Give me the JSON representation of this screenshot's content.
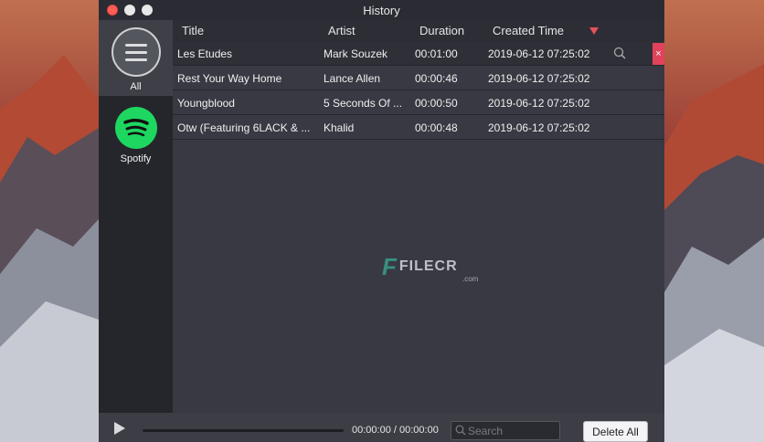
{
  "window": {
    "title": "History"
  },
  "sidebar": {
    "items": [
      {
        "label": "All",
        "icon": "menu-icon"
      },
      {
        "label": "Spotify",
        "icon": "spotify-icon"
      }
    ]
  },
  "table": {
    "columns": [
      "Title",
      "Artist",
      "Duration",
      "Created Time"
    ],
    "rows": [
      {
        "title": "Les Etudes",
        "artist": "Mark Souzek",
        "duration": "00:01:00",
        "created": "2019-06-12 07:25:02"
      },
      {
        "title": "Rest Your Way Home",
        "artist": "Lance Allen",
        "duration": "00:00:46",
        "created": "2019-06-12 07:25:02"
      },
      {
        "title": "Youngblood",
        "artist": "5 Seconds Of ...",
        "duration": "00:00:50",
        "created": "2019-06-12 07:25:02"
      },
      {
        "title": "Otw (Featuring 6LACK & ...",
        "artist": "Khalid",
        "duration": "00:00:48",
        "created": "2019-06-12 07:25:02"
      }
    ]
  },
  "watermark": {
    "letter": "F",
    "text": "FILECR",
    "suffix": ".com"
  },
  "player": {
    "time": "00:00:00 / 00:00:00"
  },
  "search": {
    "placeholder": "Search"
  },
  "actions": {
    "delete_all": "Delete All",
    "row_delete": "×"
  },
  "colors": {
    "accent": "#e8505b",
    "spotify": "#1ed760",
    "delete": "#e0435b"
  }
}
